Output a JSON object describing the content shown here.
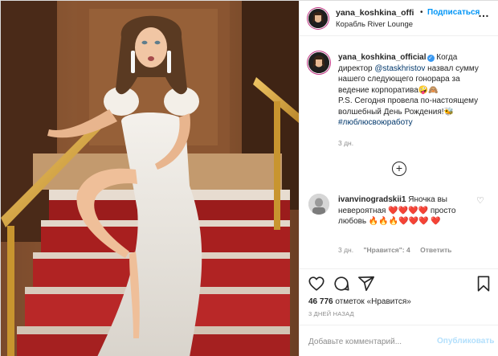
{
  "post": {
    "author": "yana_koshkina_offi",
    "follow_dot": "•",
    "follow_label": "Подписаться",
    "location": "Корабль River Lounge",
    "more_label": "…",
    "caption": {
      "author": "yana_koshkina_official",
      "verified_mark": "✓",
      "text_before": " Когда директор ",
      "mention": "@staskhristov",
      "text_after": " назвал сумму нашего следующего гонорара за ведение корпоратива🤪🙈",
      "ps": "P.S. Сегодня провела по-настоящему волшебный День Рождения!🐝",
      "hashtag": "#люблюсвоюработу",
      "time": "3 дн."
    },
    "more_comments_label": "+",
    "comment": {
      "author": "ivanvinogradskii1",
      "text": " Яночка вы невероятная ❤️❤️❤️❤️ просто любовь 🔥🔥🔥❤️❤️❤️ ❤️",
      "time": "3 дн.",
      "likes": "\"Нравится\": 4",
      "reply": "Ответить",
      "like_icon": "♡"
    },
    "likes_count": "46 776",
    "likes_text": " отметок «Нравится»",
    "ago": "3 ДНЕЙ НАЗАД",
    "add_comment_placeholder": "Добавьте комментарий...",
    "publish_label": "Опубликовать"
  },
  "colors": {
    "accent": "#0095f6",
    "link": "#00376b",
    "muted": "#8e8e8e",
    "publish_disabled": "#b2dffc"
  }
}
